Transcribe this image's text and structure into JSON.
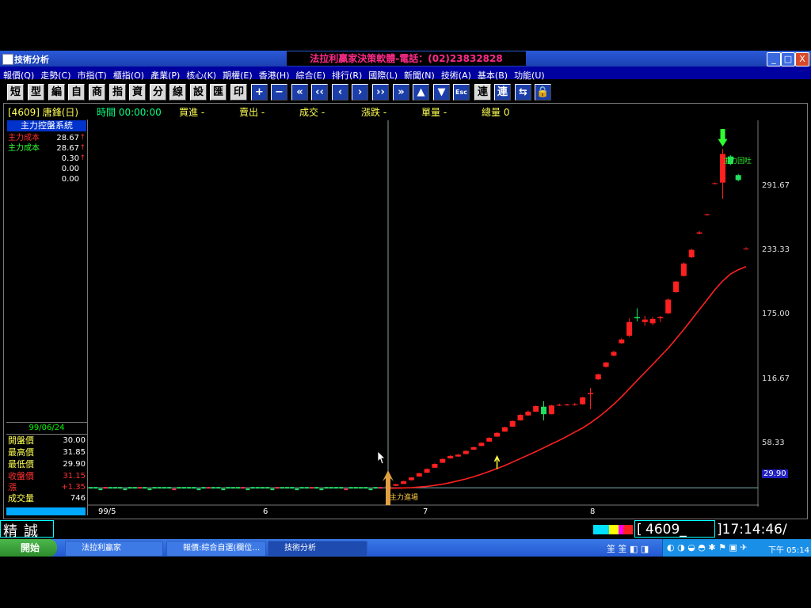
{
  "window": {
    "title": "技術分析",
    "banner": "法拉利贏家決策軟體-電話：(02)23832828",
    "controls": [
      "_",
      "□",
      "X"
    ]
  },
  "menu": [
    "報價(Q)",
    "走勢(C)",
    "市指(T)",
    "櫃指(O)",
    "產業(P)",
    "核心(K)",
    "期權(E)",
    "香港(H)",
    "綜合(E)",
    "排行(R)",
    "國際(L)",
    "新聞(N)",
    "技術(A)",
    "基本(B)",
    "功能(U)"
  ],
  "toolbar": {
    "text_buttons": [
      "短",
      "型",
      "編",
      "自",
      "商",
      "指",
      "資",
      "分",
      "線",
      "設",
      "匯",
      "印"
    ],
    "right_buttons": [
      "連",
      "連"
    ]
  },
  "infobar": {
    "code_name": "[4609] 唐鋒(日)",
    "time": "時間 00:00:00",
    "buy": "買進 -",
    "sell": "賣出 -",
    "deal": "成交 -",
    "change": "漲跌 -",
    "volume": "單量 -",
    "total": "總量 0"
  },
  "leftpanel": {
    "header": "主力控盤系統",
    "rows": [
      {
        "label": "主力成本",
        "value": "28.67",
        "arrow": "↑",
        "color": "#ff3030"
      },
      {
        "label": "主力成本",
        "value": "28.67",
        "arrow": "↑",
        "color": "#30ff30"
      },
      {
        "label": "",
        "value": "0.30",
        "arrow": "↑",
        "color": "#ffffff"
      },
      {
        "label": "",
        "value": "0.00",
        "arrow": "",
        "color": "#ffffff"
      },
      {
        "label": "",
        "value": "0.00",
        "arrow": "",
        "color": "#ffffff"
      }
    ],
    "date": "99/06/24",
    "prices": [
      {
        "label": "開盤價",
        "value": "30.00",
        "color": "#ffff55",
        "vcolor": "#ffffff"
      },
      {
        "label": "最高價",
        "value": "31.85",
        "color": "#ffff55",
        "vcolor": "#ffffff"
      },
      {
        "label": "最低價",
        "value": "29.90",
        "color": "#ffff55",
        "vcolor": "#ffffff"
      },
      {
        "label": "收盤價",
        "value": "31.15",
        "color": "#ff3030",
        "vcolor": "#ff3030"
      },
      {
        "label": "漲",
        "value": "+1.35",
        "color": "#ff3030",
        "vcolor": "#ff3030"
      },
      {
        "label": "成交量",
        "value": "746",
        "color": "#ffff55",
        "vcolor": "#ffffff"
      }
    ]
  },
  "chart_data": {
    "type": "candlestick",
    "y_ticks": [
      58.33,
      116.67,
      175.0,
      233.33,
      291.67
    ],
    "ylim": [
      16,
      325
    ],
    "current_price_label": "29.90",
    "current_price": 29.9,
    "x_tick_labels": [
      "99/5",
      "6",
      "7",
      "8"
    ],
    "annotations": [
      {
        "text": "主力回吐",
        "color": "#30ff30"
      },
      {
        "text": "主力進場",
        "color": "#ffcc44"
      }
    ],
    "candles": [
      {
        "o": 30.0,
        "h": 31.85,
        "l": 29.9,
        "c": 31.15
      },
      {
        "o": 31.5,
        "h": 33.0,
        "l": 31.2,
        "c": 32.8
      },
      {
        "o": 33.0,
        "h": 35.5,
        "l": 32.9,
        "c": 35.2
      },
      {
        "o": 36.0,
        "h": 38.5,
        "l": 35.8,
        "c": 38.2
      },
      {
        "o": 39.0,
        "h": 42.0,
        "l": 38.8,
        "c": 41.6
      },
      {
        "o": 42.0,
        "h": 45.5,
        "l": 41.8,
        "c": 45.0
      },
      {
        "o": 46.0,
        "h": 49.5,
        "l": 45.8,
        "c": 49.0
      },
      {
        "o": 50.0,
        "h": 53.5,
        "l": 49.8,
        "c": 53.0
      },
      {
        "o": 53.5,
        "h": 56.0,
        "l": 53.2,
        "c": 55.5
      },
      {
        "o": 55.0,
        "h": 57.0,
        "l": 54.8,
        "c": 56.5
      },
      {
        "o": 57.0,
        "h": 60.0,
        "l": 56.8,
        "c": 59.5
      },
      {
        "o": 60.5,
        "h": 63.0,
        "l": 60.2,
        "c": 62.5
      },
      {
        "o": 63.5,
        "h": 66.5,
        "l": 63.2,
        "c": 66.0
      },
      {
        "o": 67.0,
        "h": 70.5,
        "l": 66.8,
        "c": 70.0
      },
      {
        "o": 71.0,
        "h": 74.5,
        "l": 70.8,
        "c": 74.0
      },
      {
        "o": 75.0,
        "h": 79.0,
        "l": 74.8,
        "c": 78.5
      },
      {
        "o": 79.0,
        "h": 84.0,
        "l": 78.8,
        "c": 83.5
      },
      {
        "o": 84.0,
        "h": 89.0,
        "l": 83.8,
        "c": 88.5
      },
      {
        "o": 88.0,
        "h": 92.0,
        "l": 87.8,
        "c": 91.0
      },
      {
        "o": 91.0,
        "h": 96.0,
        "l": 90.8,
        "c": 95.5
      },
      {
        "o": 95.0,
        "h": 99.5,
        "l": 84.0,
        "c": 89.0
      },
      {
        "o": 89.0,
        "h": 96.5,
        "l": 88.8,
        "c": 96.0
      },
      {
        "o": 96.0,
        "h": 97.5,
        "l": 95.5,
        "c": 96.5
      },
      {
        "o": 96.5,
        "h": 97.5,
        "l": 95.8,
        "c": 96.8
      },
      {
        "o": 96.5,
        "h": 98.0,
        "l": 95.8,
        "c": 97.0
      },
      {
        "o": 97.0,
        "h": 103.0,
        "l": 96.5,
        "c": 102.5
      },
      {
        "o": 105.0,
        "h": 110.0,
        "l": 93.0,
        "c": 106.0
      },
      {
        "o": 117.0,
        "h": 121.5,
        "l": 116.5,
        "c": 121.0
      },
      {
        "o": 127.0,
        "h": 131.0,
        "l": 126.5,
        "c": 130.5
      },
      {
        "o": 136.0,
        "h": 140.0,
        "l": 135.5,
        "c": 139.0
      },
      {
        "o": 146.0,
        "h": 150.0,
        "l": 145.5,
        "c": 149.0
      },
      {
        "o": 152.0,
        "h": 166.0,
        "l": 151.0,
        "c": 163.0
      },
      {
        "o": 167.0,
        "h": 174.0,
        "l": 163.5,
        "c": 166.0
      },
      {
        "o": 163.0,
        "h": 168.0,
        "l": 160.0,
        "c": 165.0
      },
      {
        "o": 162.0,
        "h": 167.0,
        "l": 160.5,
        "c": 165.5
      },
      {
        "o": 166.0,
        "h": 168.0,
        "l": 163.0,
        "c": 167.0
      },
      {
        "o": 170.0,
        "h": 182.0,
        "l": 169.5,
        "c": 181.0
      },
      {
        "o": 187.0,
        "h": 196.0,
        "l": 186.5,
        "c": 195.5
      },
      {
        "o": 200.0,
        "h": 211.0,
        "l": 199.5,
        "c": 210.0
      },
      {
        "o": 215.0,
        "h": 222.0,
        "l": 214.5,
        "c": 221.0
      },
      {
        "o": 234.0,
        "h": 236.0,
        "l": 233.5,
        "c": 235.0
      },
      {
        "o": 249.0,
        "h": 250.0,
        "l": 248.5,
        "c": 249.5
      },
      {
        "o": 274.0,
        "h": 275.0,
        "l": 273.5,
        "c": 274.5
      },
      {
        "o": 275.0,
        "h": 302.0,
        "l": 262.0,
        "c": 298.0
      },
      {
        "o": 296.0,
        "h": 297.0,
        "l": 289.0,
        "c": 290.0
      },
      {
        "o": 281.0,
        "h": 282.0,
        "l": 276.0,
        "c": 277.0
      },
      {
        "o": 222.0,
        "h": 223.0,
        "l": 221.5,
        "c": 222.0
      }
    ],
    "ma_line": [
      29.5,
      29.6,
      29.8,
      30.0,
      30.5,
      31.0,
      31.8,
      32.8,
      34.0,
      35.5,
      37.0,
      38.8,
      40.8,
      43.0,
      45.3,
      47.8,
      50.5,
      53.3,
      56.2,
      59.0,
      62.0,
      65.0,
      68.0,
      71.2,
      74.6,
      78.0,
      82.0,
      86.5,
      91.5,
      97.0,
      103.0,
      109.5,
      116.0,
      122.5,
      129.0,
      135.5,
      142.0,
      149.5,
      157.0,
      165.0,
      173.0,
      181.0,
      189.0,
      196.0,
      201.5,
      205.0,
      207.5
    ],
    "flat_volume_bars_before_entry": 60
  },
  "status": {
    "stock_name": "精誠",
    "code": "4609_",
    "time": "]17:14:46/",
    "code_prefix": "[",
    "color_blocks": [
      "#00e0ff",
      "#ffff00",
      "#ff00ff",
      "#ff2020"
    ]
  },
  "taskbar": {
    "start": "開始",
    "tasks": [
      "法拉利贏家",
      "報價:綜合自選(欄位…",
      "技術分析"
    ],
    "clock": "下午 05:14"
  }
}
